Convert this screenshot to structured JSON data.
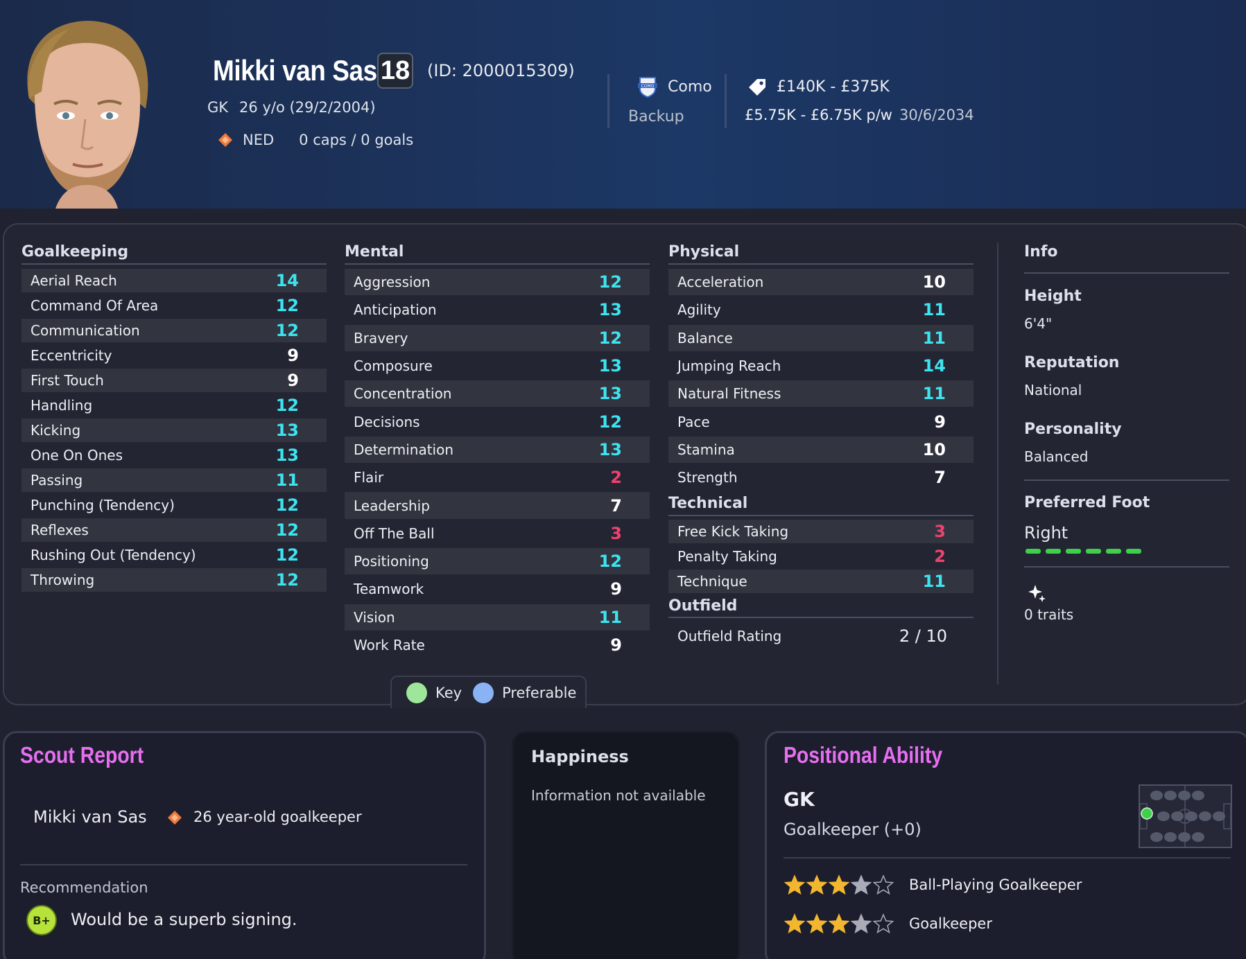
{
  "player": {
    "name": "Mikki van Sas",
    "number": "18",
    "id": "(ID: 2000015309)",
    "position": "GK",
    "age": "26 y/o (29/2/2004)",
    "nation": "NED",
    "caps": "0 caps / 0 goals",
    "club": "Como",
    "role": "Backup",
    "value": "£140K - £375K",
    "wage": "£5.75K - £6.75K p/w",
    "contract_expiry": "30/6/2034"
  },
  "sections": {
    "goalkeeping": "Goalkeeping",
    "mental": "Mental",
    "physical": "Physical",
    "technical": "Technical",
    "outfield": "Outfield",
    "info": "Info"
  },
  "goalkeeping": [
    {
      "label": "Aerial Reach",
      "value": "14",
      "tone": "c"
    },
    {
      "label": "Command Of Area",
      "value": "12",
      "tone": "c"
    },
    {
      "label": "Communication",
      "value": "12",
      "tone": "c"
    },
    {
      "label": "Eccentricity",
      "value": "9",
      "tone": "w"
    },
    {
      "label": "First Touch",
      "value": "9",
      "tone": "w"
    },
    {
      "label": "Handling",
      "value": "12",
      "tone": "c"
    },
    {
      "label": "Kicking",
      "value": "13",
      "tone": "c"
    },
    {
      "label": "One On Ones",
      "value": "13",
      "tone": "c"
    },
    {
      "label": "Passing",
      "value": "11",
      "tone": "c"
    },
    {
      "label": "Punching (Tendency)",
      "value": "12",
      "tone": "c"
    },
    {
      "label": "Reflexes",
      "value": "12",
      "tone": "c"
    },
    {
      "label": "Rushing Out (Tendency)",
      "value": "12",
      "tone": "c"
    },
    {
      "label": "Throwing",
      "value": "12",
      "tone": "c"
    }
  ],
  "mental": [
    {
      "label": "Aggression",
      "value": "12",
      "tone": "c"
    },
    {
      "label": "Anticipation",
      "value": "13",
      "tone": "c"
    },
    {
      "label": "Bravery",
      "value": "12",
      "tone": "c"
    },
    {
      "label": "Composure",
      "value": "13",
      "tone": "c"
    },
    {
      "label": "Concentration",
      "value": "13",
      "tone": "c"
    },
    {
      "label": "Decisions",
      "value": "12",
      "tone": "c"
    },
    {
      "label": "Determination",
      "value": "13",
      "tone": "c"
    },
    {
      "label": "Flair",
      "value": "2",
      "tone": "r"
    },
    {
      "label": "Leadership",
      "value": "7",
      "tone": "w"
    },
    {
      "label": "Off The Ball",
      "value": "3",
      "tone": "r"
    },
    {
      "label": "Positioning",
      "value": "12",
      "tone": "c"
    },
    {
      "label": "Teamwork",
      "value": "9",
      "tone": "w"
    },
    {
      "label": "Vision",
      "value": "11",
      "tone": "c"
    },
    {
      "label": "Work Rate",
      "value": "9",
      "tone": "w"
    }
  ],
  "physical": [
    {
      "label": "Acceleration",
      "value": "10",
      "tone": "w"
    },
    {
      "label": "Agility",
      "value": "11",
      "tone": "c"
    },
    {
      "label": "Balance",
      "value": "11",
      "tone": "c"
    },
    {
      "label": "Jumping Reach",
      "value": "14",
      "tone": "c"
    },
    {
      "label": "Natural Fitness",
      "value": "11",
      "tone": "c"
    },
    {
      "label": "Pace",
      "value": "9",
      "tone": "w"
    },
    {
      "label": "Stamina",
      "value": "10",
      "tone": "w"
    },
    {
      "label": "Strength",
      "value": "7",
      "tone": "w"
    }
  ],
  "technical": [
    {
      "label": "Free Kick Taking",
      "value": "3",
      "tone": "r"
    },
    {
      "label": "Penalty Taking",
      "value": "2",
      "tone": "r"
    },
    {
      "label": "Technique",
      "value": "11",
      "tone": "c"
    }
  ],
  "outfield": {
    "label": "Outfield Rating",
    "value": "2 / 10"
  },
  "info": {
    "height_label": "Height",
    "height": "6'4\"",
    "reputation_label": "Reputation",
    "reputation": "National",
    "personality_label": "Personality",
    "personality": "Balanced",
    "foot_label": "Preferred Foot",
    "foot": "Right",
    "traits": "0 traits"
  },
  "legend": {
    "key": "Key",
    "preferable": "Preferable"
  },
  "scout": {
    "title": "Scout Report",
    "name": "Mikki van Sas",
    "summary": "26 year-old goalkeeper",
    "recommendation_label": "Recommendation",
    "grade": "B+",
    "recommendation": "Would be a superb signing."
  },
  "happiness": {
    "title": "Happiness",
    "text": "Information not available"
  },
  "positional": {
    "title": "Positional Ability",
    "position": "GK",
    "role": "Goalkeeper (+0)",
    "roles": [
      {
        "name": "Ball-Playing Goalkeeper",
        "stars": 3.5
      },
      {
        "name": "Goalkeeper",
        "stars": 3.5
      }
    ]
  },
  "colors": {
    "accent_cyan": "#3ee3f0",
    "low_red": "#f2416e",
    "title_pink": "#e66ff0",
    "foot_green": "#3ed04a"
  }
}
